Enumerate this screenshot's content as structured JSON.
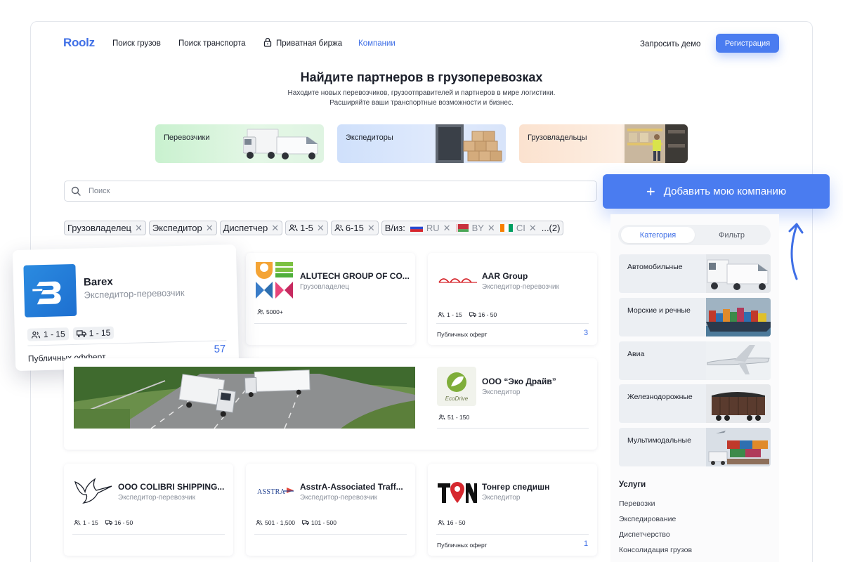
{
  "header": {
    "logo": "Roolz",
    "nav": [
      "Поиск грузов",
      "Поиск транспорта",
      "Приватная биржа",
      "Компании"
    ],
    "demo": "Запросить демо",
    "register": "Регистрация"
  },
  "hero": {
    "title": "Найдите партнеров в грузоперевозках",
    "sub1": "Находите новых перевозчиков, грузоотправителей и партнеров в мире логистики.",
    "sub2": "Расширяйте ваши транспортные возможности и бизнес."
  },
  "tiles": [
    "Перевозчики",
    "Экспедиторы",
    "Грузовладельцы"
  ],
  "search": {
    "placeholder": "Поиск"
  },
  "chips": {
    "c1": "Грузовладелец",
    "c2": "Экспедитор",
    "c3": "Диспетчер",
    "c4": "1-5",
    "c5": "6-15",
    "from": "В/из:",
    "ru": "RU",
    "by": "BY",
    "ci": "CI",
    "more": "...(2)"
  },
  "add_company": "Добавить мою компанию",
  "sidebar": {
    "tab_category": "Категория",
    "tab_filter": "Фильтр",
    "categories": [
      "Автомобильные",
      "Морские и речные",
      "Авиа",
      "Железнодорожные",
      "Мультимодальные"
    ],
    "services_title": "Услуги",
    "services": [
      "Перевозки",
      "Экспедирование",
      "Диспетчерство",
      "Консолидация грузов"
    ]
  },
  "featured": {
    "name": "Barex",
    "role": "Экспедитор-перевозчик",
    "emp": "1 - 15",
    "trucks": "1 - 15",
    "offer_label": "Публичных офферт",
    "offers": "57"
  },
  "cards": {
    "alutech": {
      "name": "ALUTECH GROUP OF CO...",
      "role": "Грузовладелец",
      "emp": "5000+"
    },
    "aar": {
      "name": "AAR Group",
      "role": "Экспедитор-перевозчик",
      "emp": "1 - 15",
      "trucks": "16 - 50",
      "offer_label": "Публичных оферт",
      "offers": "3"
    },
    "eco": {
      "name": "ООО “Эко Драйв”",
      "role": "Экспедитор",
      "emp": "51 - 150",
      "logo_text": "EcoDrive"
    },
    "colibri": {
      "name": "ООО COLIBRI SHIPPING...",
      "role": "Экспедитор-перевозчик",
      "emp": "1 - 15",
      "trucks": "16 - 50"
    },
    "asstra": {
      "name": "AsstrA-Associated Traff...",
      "role": "Экспедитор-перевозчик",
      "emp": "501 - 1,500",
      "trucks": "101 - 500",
      "logo_text": "ASSTRA"
    },
    "tonger": {
      "name": "Тонгер спедишн",
      "role": "Экспедитор",
      "emp": "16 - 50",
      "offer_label": "Публичных оферт",
      "offers": "1"
    }
  },
  "colors": {
    "accent": "#4a7cf0",
    "text": "#1b1f2a",
    "muted": "#8a909b"
  }
}
